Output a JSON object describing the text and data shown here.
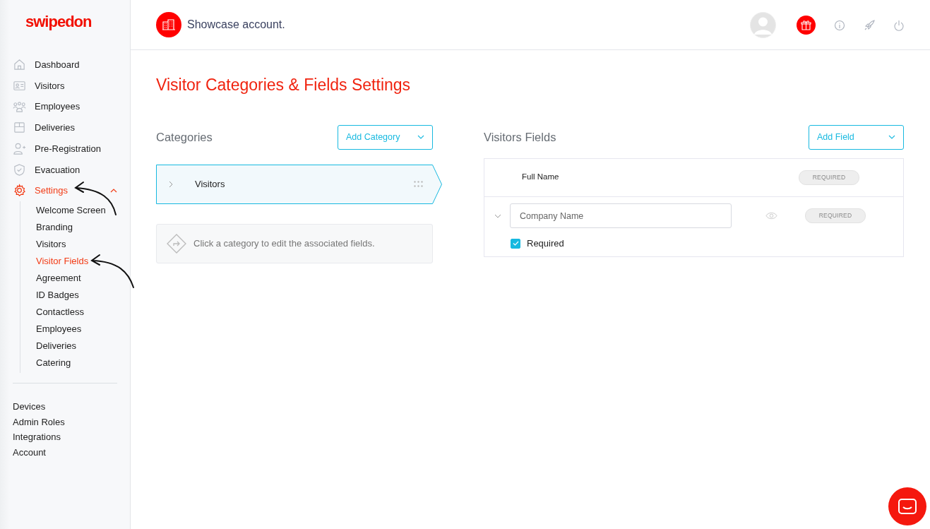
{
  "logo": "swipedon",
  "sidebar": {
    "items": [
      {
        "label": "Dashboard",
        "selected": false
      },
      {
        "label": "Visitors",
        "selected": false
      },
      {
        "label": "Employees",
        "selected": false
      },
      {
        "label": "Deliveries",
        "selected": false
      },
      {
        "label": "Pre-Registration",
        "selected": false
      },
      {
        "label": "Evacuation",
        "selected": false
      },
      {
        "label": "Settings",
        "selected": true,
        "expanded": true,
        "children": [
          {
            "label": "Welcome Screen",
            "selected": false
          },
          {
            "label": "Branding",
            "selected": false
          },
          {
            "label": "Visitors",
            "selected": false
          },
          {
            "label": "Visitor Fields",
            "selected": true
          },
          {
            "label": "Agreement",
            "selected": false
          },
          {
            "label": "ID Badges",
            "selected": false
          },
          {
            "label": "Contactless",
            "selected": false
          },
          {
            "label": "Employees",
            "selected": false
          },
          {
            "label": "Deliveries",
            "selected": false
          },
          {
            "label": "Catering",
            "selected": false
          }
        ]
      }
    ],
    "secondary": [
      "Devices",
      "Admin Roles",
      "Integrations",
      "Account"
    ]
  },
  "header": {
    "account": "Showcase account."
  },
  "page_title": "Visitor Categories & Fields Settings",
  "categories": {
    "heading": "Categories",
    "add_button": "Add Category",
    "items": [
      {
        "label": "Visitors",
        "selected": true
      }
    ],
    "hint": "Click a category to edit the associated fields."
  },
  "fields": {
    "heading": "Visitors Fields",
    "add_button": "Add Field",
    "rows": [
      {
        "kind": "static",
        "label": "Full Name",
        "badge": "REQUIRED"
      },
      {
        "kind": "editable",
        "placeholder": "Company Name",
        "badge": "REQUIRED",
        "expanded": true,
        "required_label": "Required",
        "required": true
      }
    ]
  }
}
